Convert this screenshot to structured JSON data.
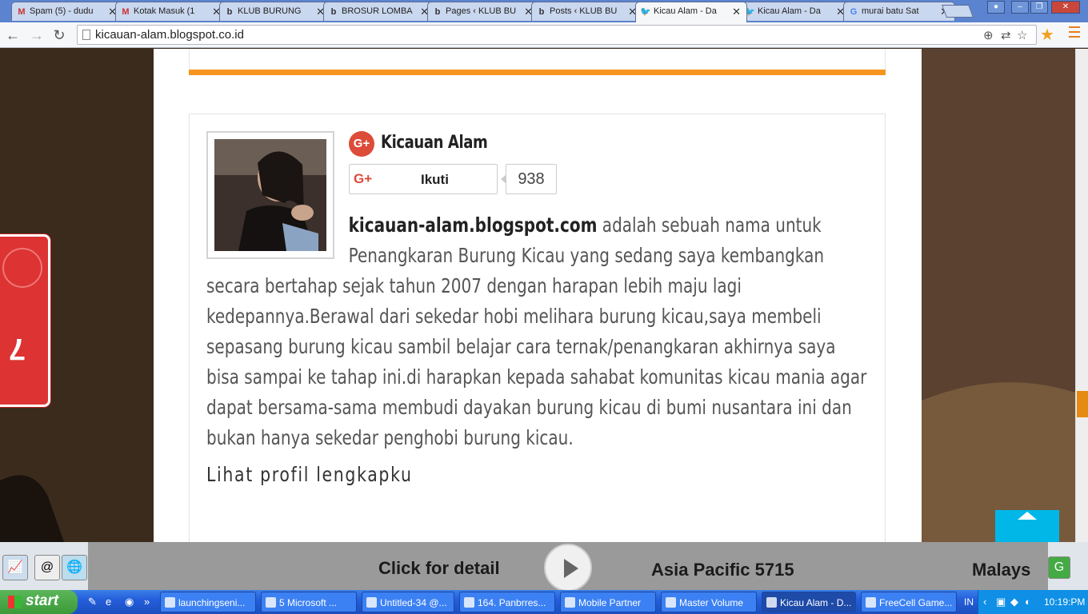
{
  "browser": {
    "tabs": [
      {
        "label": "Spam (5) - dudu",
        "favicon": "M"
      },
      {
        "label": "Kotak Masuk (1",
        "favicon": "M"
      },
      {
        "label": "KLUB BURUNG",
        "favicon": "b"
      },
      {
        "label": "BROSUR LOMBA",
        "favicon": "b"
      },
      {
        "label": "Pages ‹ KLUB BU",
        "favicon": "b"
      },
      {
        "label": "Posts ‹ KLUB BU",
        "favicon": "b"
      },
      {
        "label": "Kicau Alam - Da",
        "favicon": "bird"
      },
      {
        "label": "Kicau Alam - Da",
        "favicon": "bird"
      },
      {
        "label": "murai batu Sat",
        "favicon": "G"
      }
    ],
    "url": "kicauan-alam.blogspot.co.id",
    "accent": "#f7941d"
  },
  "profile": {
    "gplus_icon": "G+",
    "name": "Kicauan Alam",
    "follow_label": "Ikuti",
    "follow_icon": "G+",
    "follower_count": "938",
    "about_site": "kicauan-alam.blogspot.com",
    "about_text": " adalah sebuah nama untuk Penangkaran Burung Kicau yang sedang saya kembangkan secara bertahap sejak tahun 2007 dengan harapan lebih maju lagi kedepannya.Berawal dari sekedar hobi melihara burung kicau,saya membeli sepasang burung kicau sambil belajar cara ternak/penangkaran akhirnya saya bisa sampai ke tahap ini.di harapkan kepada sahabat komunitas kicau mania agar dapat bersama-sama membudi dayakan burung kicau di bumi nusantara ini dan bukan hanya sekedar penghobi burung kicau.",
    "profile_link": "Lihat profil lengkapku"
  },
  "side_widget": {
    "number": "7"
  },
  "ad": {
    "click_text": "Click for detail",
    "asia_text": "Asia Pacific 5715",
    "malay_text": "Malays"
  },
  "taskbar": {
    "start_label": "start",
    "tasks": [
      {
        "label": "launchingseni..."
      },
      {
        "label": "5 Microsoft ..."
      },
      {
        "label": "Untitled-34 @..."
      },
      {
        "label": "164. Panbrres..."
      },
      {
        "label": "Mobile Partner"
      },
      {
        "label": "Master Volume"
      },
      {
        "label": "Kicau Alam - D..."
      },
      {
        "label": "FreeCell Game..."
      }
    ],
    "language": "IN",
    "clock": "10:19:PM"
  }
}
